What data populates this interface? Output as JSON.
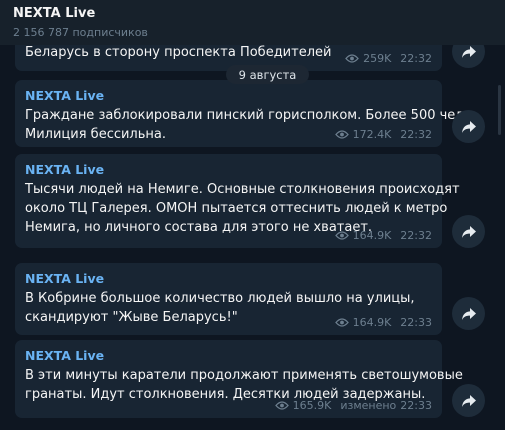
{
  "header": {
    "channel_name": "NEXTA Live",
    "subscribers": "2 156 787 подписчиков"
  },
  "date_separator": "9 августа",
  "messages": [
    {
      "sender": "",
      "text": "Беларусь в сторону проспекта Победителей",
      "views": "259K",
      "time": "22:32",
      "edited": ""
    },
    {
      "sender": "NEXTA Live",
      "text": "Граждане заблокировали пинский горисполком. Более 500 чел.\nМилиция бессильна.",
      "views": "172.4K",
      "time": "22:32",
      "edited": ""
    },
    {
      "sender": "NEXTA Live",
      "text": "Тысячи людей на Немиге. Основные столкновения происходят\nоколо ТЦ Галерея. ОМОН пытается оттеснить людей к метро\nНемига, но личного состава для этого не хватает.",
      "views": "164.9K",
      "time": "22:32",
      "edited": ""
    },
    {
      "sender": "NEXTA Live",
      "text": "В Кобрине большое количество людей вышло на улицы,\nскандируют \"Жыве Беларусь!\"",
      "views": "164.9K",
      "time": "22:33",
      "edited": ""
    },
    {
      "sender": "NEXTA Live",
      "text": "В эти минуты каратели продолжают применять светошумовые\nгранаты. Идут столкновения. Десятки людей задержаны.",
      "views": "165.9K",
      "time": "22:33",
      "edited": "изменено"
    }
  ],
  "icons": {
    "views": "eye-icon",
    "share": "share-arrow-icon"
  },
  "colors": {
    "background": "#0e1621",
    "header": "#17212b",
    "bubble": "#182533",
    "sender": "#6ab3f3",
    "meta": "#6d7f8f"
  }
}
